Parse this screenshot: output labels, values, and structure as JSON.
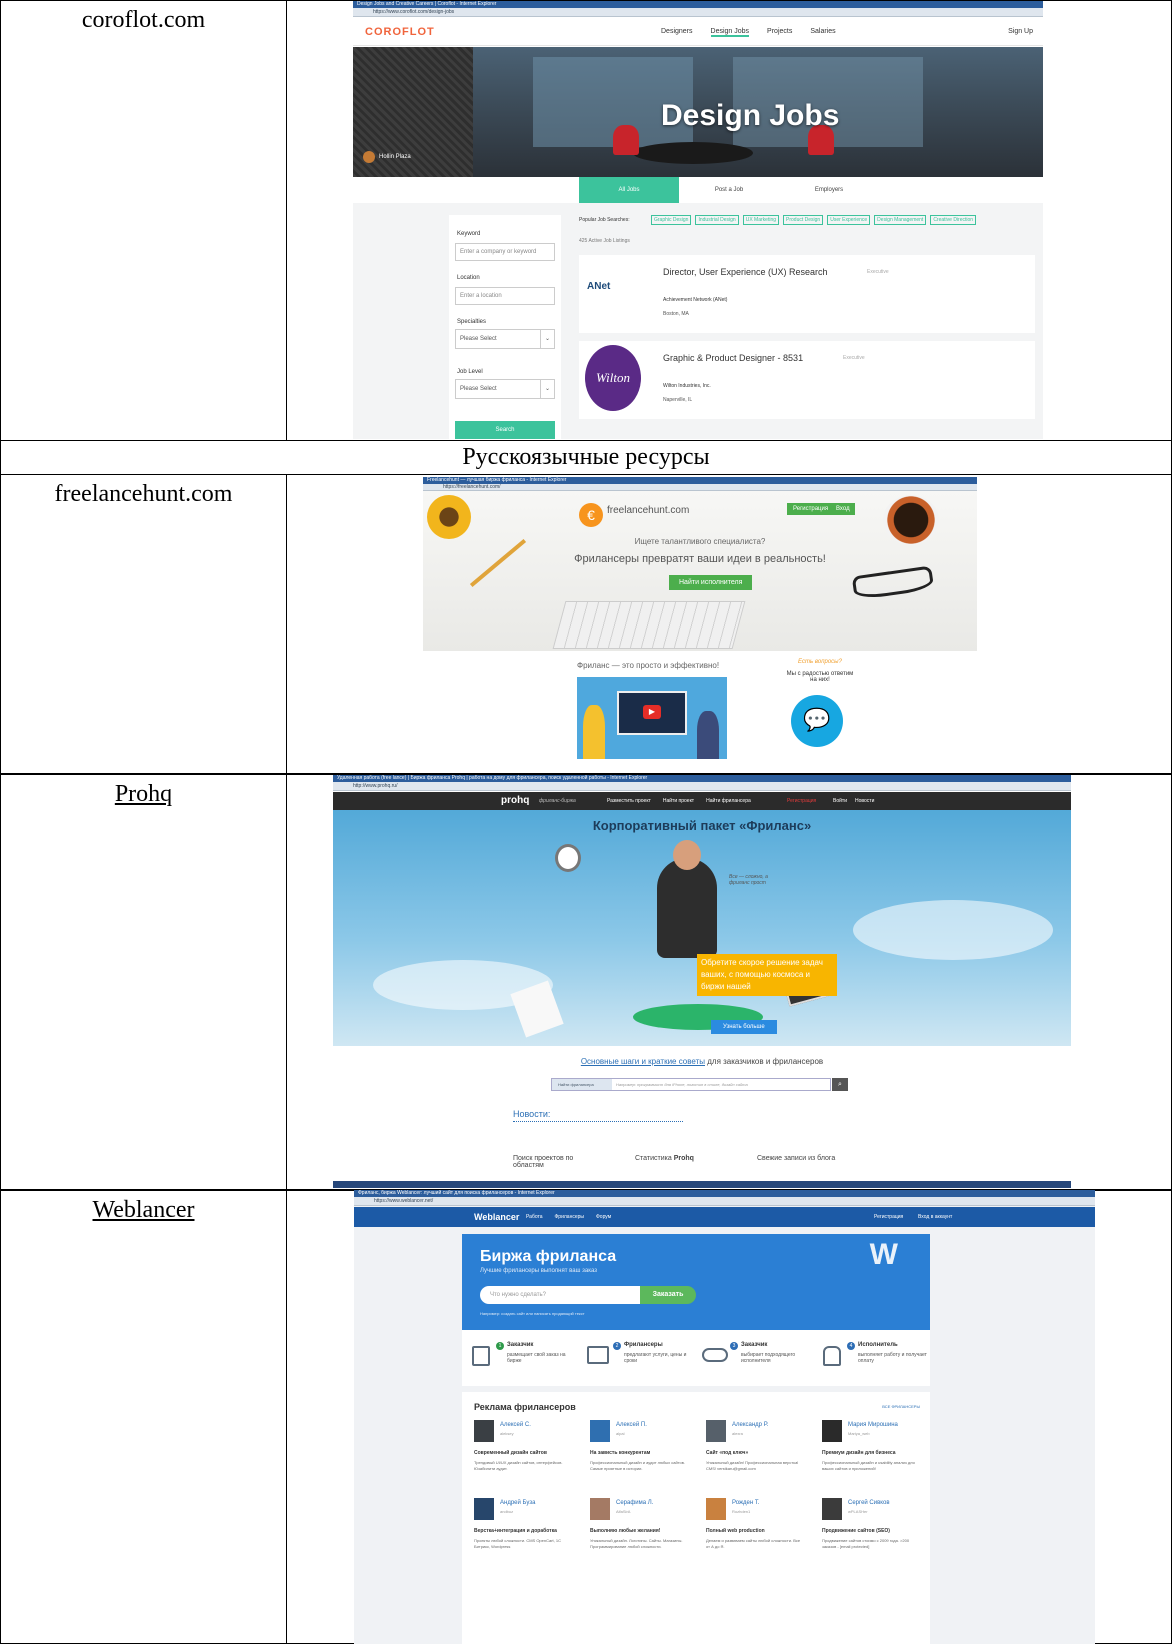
{
  "rows": {
    "coroflot": {
      "label": "coroflot.com"
    },
    "section": {
      "label": "Русскоязычные ресурсы"
    },
    "freelancehunt": {
      "label": "freelancehunt.com"
    },
    "prohq": {
      "label": "Prohq"
    },
    "weblancer": {
      "label": "Weblancer"
    }
  },
  "coroflot": {
    "window_title": "Design Jobs and Creative Careers | Coroflot - Internet Explorer",
    "url": "https://www.coroflot.com/design-jobs",
    "logo": "COROFLOT",
    "nav": [
      "Designers",
      "Design Jobs",
      "Projects",
      "Salaries"
    ],
    "signup": "Sign Up",
    "hero_title": "Design Jobs",
    "hero_credit": "Hollin Plaza",
    "tabs": [
      "All Jobs",
      "Post a Job",
      "Employers"
    ],
    "popular_label": "Popular Job Searches:",
    "popular": [
      "Graphic Design",
      "Industrial Design",
      "UX Marketing",
      "Product Design",
      "User Experience",
      "Design Management",
      "Creative Direction"
    ],
    "count": "425 Active Job Listings",
    "keyword_label": "Keyword",
    "keyword_placeholder": "Enter a company or keyword",
    "location_label": "Location",
    "location_placeholder": "Enter a location",
    "spec_label": "Specialties",
    "spec_value": "Please Select",
    "level_label": "Job Level",
    "level_value": "Please Select",
    "search": "Search",
    "jobs": [
      {
        "title": "Director, User Experience (UX) Research",
        "level": "Executive",
        "company": "Achievement Network (ANet)",
        "place": "Boston, MA",
        "logo": "ANet"
      },
      {
        "title": "Graphic & Product Designer - 8531",
        "level": "Executive",
        "company": "Wilton Industries, Inc.",
        "place": "Naperville, IL",
        "logo": "Wilton"
      }
    ]
  },
  "freelancehunt": {
    "window_title": "Freelancehunt — лучшая биржа фриланса - Internet Explorer",
    "url": "https://freelancehunt.com/",
    "logo": "freelancehunt.com",
    "register": "Регистрация",
    "login": "Вход",
    "lead": "Ищете талантливого специалиста?",
    "headline": "Фрилансеры превратят ваши идеи в реальность!",
    "cta": "Найти исполнителя",
    "easy": "Фриланс — это просто и эффективно!",
    "questions": "Есть вопросы?",
    "answers": "Мы с радостью ответим на них!"
  },
  "prohq": {
    "window_title": "Удаленная работа (free lance) | Биржа фриланса Prohq | работа на дому для фрилансера, поиск удаленной работы - Internet Explorer",
    "url": "http://www.prohq.ru/",
    "logo": "prohq",
    "tagline": "фриланс-биржа",
    "nav": [
      "Разместить проект",
      "Найти проект",
      "Найти фрилансера"
    ],
    "register": "Регистрация",
    "login": "Войти",
    "news_link": "Новости",
    "headline": "Корпоративный пакет «Фриланс»",
    "note": "Все — сложно, а фриланс прост",
    "promo": "Обретите скорое решение задач ваших, с помощью космоса и биржи нашей",
    "more": "Узнать больше",
    "steps_link": "Основные шаги и краткие советы",
    "steps_rest": "для заказчиков и фрилансеров",
    "search_select": "Найти фрилансера",
    "search_placeholder": "Например: программист для iPhone, логотип в стиле, дизайн сайта",
    "news_title": "Новости:",
    "col1": "Поиск проектов по областям",
    "col2": "Статистика",
    "col2_bold": "Prohq",
    "col3": "Свежие записи из блога"
  },
  "weblancer": {
    "window_title": "Фриланс, биржа Weblancer: лучший сайт для поиска фрилансеров - Internet Explorer",
    "url": "https://www.weblancer.net/",
    "logo": "Weblancer",
    "nav": [
      "Работа",
      "Фрилансеры",
      "Форум"
    ],
    "register": "Регистрация",
    "login": "Вход в аккаунт",
    "hero_title": "Биржа фриланса",
    "hero_sub": "Лучшие фрилансеры выполнят ваш заказ",
    "input_placeholder": "Что нужно сделать?",
    "order": "Заказать",
    "example": "Например: создать сайт или написать продающий текст",
    "steps": [
      {
        "num": "1",
        "title": "Заказчик",
        "desc": "размещает свой заказ на бирже",
        "color": "#2e9a4a"
      },
      {
        "num": "2",
        "title": "Фрилансеры",
        "desc": "предлагают услуги, цены и сроки",
        "color": "#2d6db5"
      },
      {
        "num": "3",
        "title": "Заказчик",
        "desc": "выбирает подходящего исполнителя",
        "color": "#2d6db5"
      },
      {
        "num": "4",
        "title": "Исполнитель",
        "desc": "выполняет работу и получает оплату",
        "color": "#2d6db5"
      }
    ],
    "ads_title": "Реклама фрилансеров",
    "all": "ВСЕ ФРИЛАНСЕРЫ",
    "ads": [
      {
        "name": "Алексей С.",
        "nick": "aleksey",
        "title": "Современный дизайн сайтов",
        "desc": "Трендовый UI/UX дизайн сайтов, интерфейсов. Юзабилити аудит."
      },
      {
        "name": "Алексей П.",
        "nick": "alpal",
        "title": "На зависть конкурентам",
        "desc": "Профессиональный дизайн и аудит любых сайтов. Самые приятные в истории."
      },
      {
        "name": "Александр Р.",
        "nick": "alexra",
        "title": "Сайт «под ключ»",
        "desc": "Уникальный дизайн! Профессиональная верстка! CMS! verstkaru@gmail.com"
      },
      {
        "name": "Мария Мирошина",
        "nick": "Mariya_web",
        "title": "Премиум дизайн для бизнеса",
        "desc": "Профессиональный дизайн и usability анализ для ваших сайтов и приложений!"
      },
      {
        "name": "Андрей Буза",
        "nick": "andbuz",
        "title": "Верстка+интеграция и доработка",
        "desc": "Проекты любой сложности. CMS OpenCart, 1С Битрикс, Wordpress"
      },
      {
        "name": "Серафима Л.",
        "nick": "AlfaSirA",
        "title": "Выполняю любые желания!",
        "desc": "Уникальный дизайн. Логотипы. Сайты. Магазины. Программирование любой сложности."
      },
      {
        "name": "Рожден Т.",
        "nick": "Rozhden1",
        "title": "Полный web production",
        "desc": "Делаем и развиваем сайты любой сложности. Все от А до Я."
      },
      {
        "name": "Сергей Сивков",
        "nick": "wPLASHer",
        "title": "Продвижение сайтов (SEO)",
        "desc": "Продвижение сайтов стоимо с 2009 года. >200 заказов - [email protected]"
      }
    ]
  }
}
